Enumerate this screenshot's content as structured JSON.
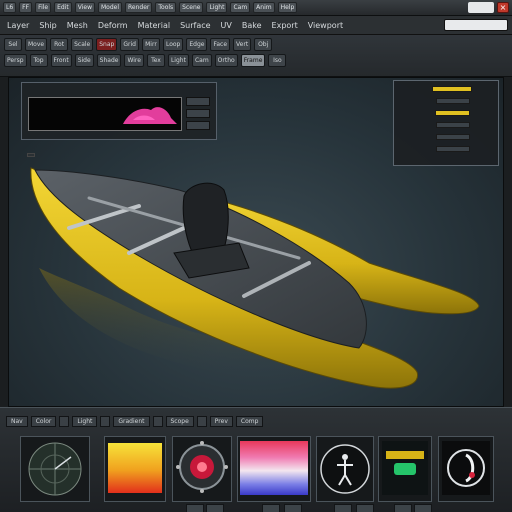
{
  "titlebar": {
    "left_label": "L6",
    "buttons": [
      "FF",
      "File",
      "Edit",
      "View",
      "Model",
      "Render",
      "Tools",
      "Scene",
      "Light",
      "Cam",
      "Anim",
      "Help"
    ],
    "right_label": ""
  },
  "menubar": {
    "items": [
      "Layer",
      "Ship",
      "Mesh",
      "Deform",
      "Material",
      "Surface",
      "UV",
      "Bake",
      "Export",
      "Viewport"
    ],
    "search_placeholder": ""
  },
  "toolbar": {
    "row1": [
      "Sel",
      "Move",
      "Rot",
      "Scale",
      "Snap",
      "Grid",
      "Mirr",
      "Loop",
      "Edge",
      "Face",
      "Vert",
      "Obj"
    ],
    "row2": [
      "Persp",
      "Top",
      "Front",
      "Side",
      "Shade",
      "Wire",
      "Tex",
      "Light",
      "Cam",
      "Ortho",
      "Frame",
      "Iso"
    ]
  },
  "viewport": {
    "panel_left": {
      "header": "",
      "screen_label": "",
      "screen_sublabel": "",
      "side_buttons": [
        "",
        "",
        ""
      ]
    },
    "caption": "",
    "panel_right": {
      "rows": [
        {
          "label": "",
          "level": 0.9,
          "value": ""
        },
        {
          "label": "",
          "level": 0.0,
          "value": ""
        },
        {
          "label": "",
          "level": 0.8,
          "value": ""
        },
        {
          "label": "",
          "level": 0.0,
          "value": ""
        },
        {
          "label": "",
          "level": 0.0,
          "value": ""
        },
        {
          "label": "",
          "level": 0.0,
          "value": ""
        }
      ]
    },
    "model": {
      "hull_text_side": "",
      "hull_text_stern": "",
      "hull_text_bow": "",
      "colors": {
        "hull": "#e2c21f",
        "deck": "#4a4f55",
        "seat": "#1e2023",
        "water": "#2f3d44"
      }
    }
  },
  "dock": {
    "tabs": [
      "Nav",
      "Color",
      "",
      "Light",
      "",
      "Gradient",
      "",
      "Scope",
      "",
      "Prev",
      "Comp"
    ],
    "widgets": [
      {
        "name": "compass",
        "footer": ""
      },
      {
        "name": "color-gradient",
        "footer": ""
      },
      {
        "name": "dial",
        "footer": ""
      },
      {
        "name": "spectrum",
        "footer": ""
      },
      {
        "name": "figure-preview",
        "footer": ""
      },
      {
        "name": "material-preview",
        "footer": ""
      },
      {
        "name": "reel-preview",
        "footer": ""
      }
    ],
    "footer_buttons": [
      "",
      "",
      "",
      "",
      "",
      "",
      "",
      ""
    ]
  }
}
